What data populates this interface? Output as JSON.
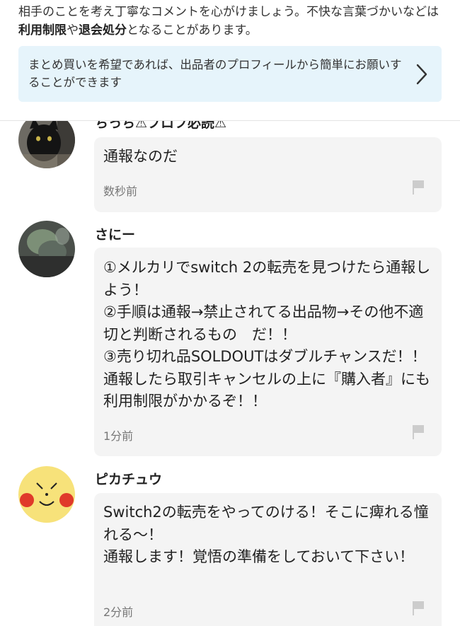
{
  "notice": {
    "part1": "相手のことを考え丁寧なコメントを心がけましょう。不快な言葉づかいなどは",
    "bold1": "利用制限",
    "part2": "や",
    "bold2": "退会処分",
    "part3": "となることがあります。"
  },
  "banner": {
    "text": "まとめ買いを希望であれば、出品者のプロフィールから簡単にお願いすることができます",
    "icon": "chevron-right-icon"
  },
  "comments": [
    {
      "name": "ちっち⚠プロフ必読⚠",
      "text": "通報なのだ",
      "time": "数秒前"
    },
    {
      "name": "さにー",
      "text": "①メルカリでswitch 2の転売を見つけたら通報しよう！\n②手順は通報→禁止されてる出品物→その他不適切と判断されるもの　だ！！\n③売り切れ品SOLDOUTはダブルチャンスだ！！通報したら取引キャンセルの上に『購入者』にも利用制限がかかるぞ！！",
      "time": "1分前"
    },
    {
      "name": "ピカチュウ",
      "text": "Switch2の転売をやってのける！そこに痺れる憧れる〜！\n通報します！覚悟の準備をしておいて下さい！",
      "time": "2分前"
    }
  ],
  "colors": {
    "banner_bg": "#e6f4fb",
    "bubble_bg": "#f4f4f4",
    "flag": "#cccccc"
  }
}
